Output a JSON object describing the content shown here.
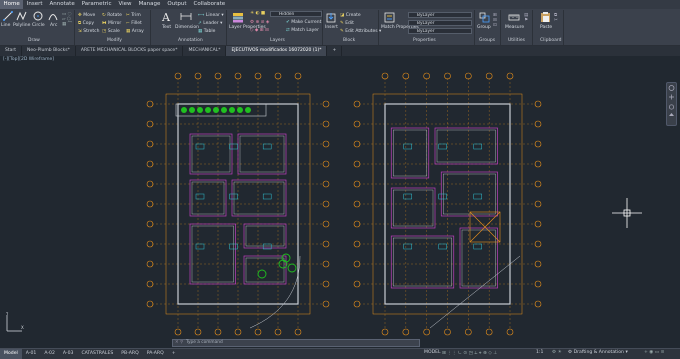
{
  "menubar": {
    "tabs": [
      "Home",
      "Insert",
      "Annotate",
      "Parametric",
      "View",
      "Manage",
      "Output",
      "Collaborate"
    ],
    "active_index": 0
  },
  "ribbon": {
    "draw": {
      "line": "Line",
      "polyline": "Polyline",
      "circle": "Circle",
      "arc": "Arc",
      "panel": "Draw"
    },
    "modify": {
      "move": "Move",
      "rotate": "Rotate",
      "trim": "Trim",
      "copy": "Copy",
      "mirror": "Mirror",
      "fillet": "Fillet",
      "stretch": "Stretch",
      "scale": "Scale",
      "array": "Array",
      "panel": "Modify"
    },
    "annotation": {
      "text": "Text",
      "dimension": "Dimension",
      "linear": "Linear",
      "leader": "Leader",
      "table": "Table",
      "panel": "Annotation"
    },
    "layers": {
      "properties": "Layer Properties",
      "layer_value": "Hidden",
      "make_current": "Make Current",
      "match_layer": "Match Layer",
      "panel": "Layers"
    },
    "block": {
      "insert": "Insert",
      "create": "Create",
      "edit": "Edit",
      "edit_attributes": "Edit Attributes",
      "panel": "Block"
    },
    "properties": {
      "match": "Match Properties",
      "bylayer_1": "ByLayer",
      "bylayer_2": "ByLayer",
      "bylayer_3": "ByLayer",
      "panel": "Properties"
    },
    "groups": {
      "group": "Group",
      "panel": "Groups"
    },
    "utilities": {
      "measure": "Measure",
      "panel": "Utilities"
    },
    "clipboard": {
      "paste": "Paste",
      "panel": "Clipboard"
    }
  },
  "doc_tabs": [
    "Start",
    "Neo-Plumb Blocks*",
    "ARETE MECHANICAL BLOCKS paper space*",
    "MECHANICAL*",
    "EJECUTIVOS modificados 16072020 (1)*"
  ],
  "active_doc_index": 4,
  "viewport": {
    "label": "[-][Top][2D Wireframe]"
  },
  "command_line": {
    "placeholder": "Type a command"
  },
  "layout_tabs": [
    "Model",
    "A-01",
    "A-02",
    "A-03",
    "CATASTRALES",
    "PB-ARQ",
    "PA-ARQ"
  ],
  "active_layout_index": 0,
  "status": {
    "mode": "MODEL",
    "scale": "1:1",
    "workspace": "Drafting & Annotation"
  },
  "colors": {
    "background": "#212830",
    "dimension": "#e8901a",
    "wall": "#c8cdd4",
    "accent_magenta": "#c040c0",
    "accent_cyan": "#30c0d0",
    "tree_green": "#20c020"
  }
}
